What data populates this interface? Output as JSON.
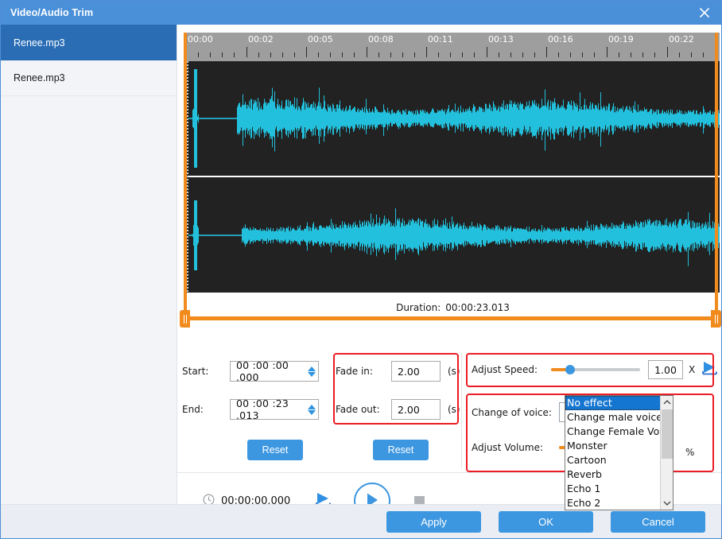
{
  "window": {
    "title": "Video/Audio Trim",
    "close_icon": "close-icon"
  },
  "sidebar": {
    "items": [
      {
        "label": "Renee.mp3",
        "selected": true
      },
      {
        "label": "Renee.mp3",
        "selected": false
      }
    ]
  },
  "timeline": {
    "ticks": [
      "00:00",
      "00:02",
      "00:05",
      "00:08",
      "00:11",
      "00:13",
      "00:16",
      "00:19",
      "00:22"
    ],
    "duration_label": "Duration:",
    "duration_value": "00:00:23.013",
    "waveform_color": "#22c0dc",
    "waveform_background": "#222222",
    "trim_marker_color": "#f28b1e"
  },
  "trim": {
    "start_label": "Start:",
    "start_value": "00 :00 :00 .000",
    "end_label": "End:",
    "end_value": "00 :00 :23 .013",
    "reset_label": "Reset"
  },
  "fade": {
    "fade_in_label": "Fade in:",
    "fade_in_value": "2.00",
    "fade_out_label": "Fade out:",
    "fade_out_value": "2.00",
    "unit": "(s)",
    "reset_label": "Reset"
  },
  "speed": {
    "label": "Adjust Speed:",
    "value": "1.00",
    "unit": "X",
    "preview_icon": "play-preview-icon",
    "slider_percent": 18
  },
  "voice": {
    "label": "Change of voice:",
    "selected": "No effect",
    "options": [
      "No effect",
      "Change male voice",
      "Change Female Voice",
      "Monster",
      "Cartoon",
      "Reverb",
      "Echo 1",
      "Echo 2"
    ]
  },
  "volume": {
    "label": "Adjust Volume:",
    "unit": "%"
  },
  "player": {
    "clock_icon": "clock-icon",
    "time": "00:00:00.000",
    "preview_icon": "play-preview-icon",
    "play_icon": "play-icon",
    "stop_icon": "stop-icon"
  },
  "footer": {
    "apply_label": "Apply",
    "ok_label": "OK",
    "cancel_label": "Cancel"
  },
  "highlight_color": "#ec1c24"
}
